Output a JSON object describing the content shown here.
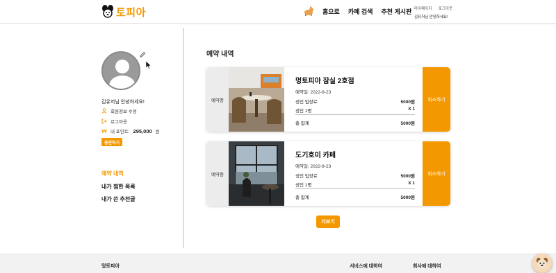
{
  "header": {
    "logo_text": "토피아",
    "nav": [
      "홈으로",
      "카페 검색",
      "추천 게시판"
    ],
    "user_links": [
      "마이페이지",
      "로그아웃"
    ],
    "user_greeting": "김유저님 안녕하세요!"
  },
  "sidebar": {
    "greeting": "김유저님 안녕하세요!",
    "edit_profile": "회원정보 수정",
    "logout": "로그아웃",
    "points_label": "내 포인트:",
    "points_value": "295,000",
    "points_unit": "원",
    "charge_button": "충전하기",
    "nav": [
      {
        "label": "예약 내역",
        "active": true
      },
      {
        "label": "내가 찜한 목록",
        "active": false
      },
      {
        "label": "내가 쓴 추천글",
        "active": false
      }
    ]
  },
  "main": {
    "title": "예약 내역",
    "reservations": [
      {
        "status": "예약중",
        "name": "멍토피아 잠실 2호점",
        "date": "예약일: 2022-9-23",
        "fee_label": "성인 입장료",
        "fee_value": "5000원",
        "qty_label": "성인 1명",
        "qty_value": "X 1",
        "total_label": "총 합계",
        "total_value": "5000원",
        "cancel": "취소하기"
      },
      {
        "status": "예약중",
        "name": "도기호미 카페",
        "date": "예약일: 2022-9-23",
        "fee_label": "성인 입장료",
        "fee_value": "5000원",
        "qty_label": "성인 1명",
        "qty_value": "X 1",
        "total_label": "총 합계",
        "total_value": "5000원",
        "cancel": "취소하기"
      }
    ],
    "more_button": "더보기"
  },
  "footer": {
    "brand": "멍토피아",
    "about_service": "서비스에 대하여",
    "about_company": "회사에 대하여"
  },
  "colors": {
    "accent": "#f39800",
    "status_bg": "#ececec",
    "footer_bg": "#f2f2f2"
  }
}
